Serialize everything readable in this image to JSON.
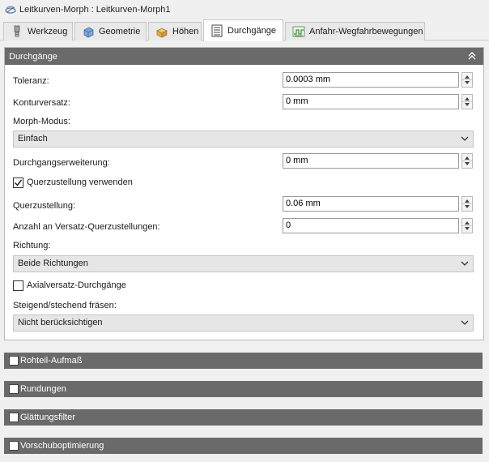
{
  "window": {
    "title": "Leitkurven-Morph : Leitkurven-Morph1"
  },
  "tabs": [
    {
      "label": "Werkzeug"
    },
    {
      "label": "Geometrie"
    },
    {
      "label": "Höhen"
    },
    {
      "label": "Durchgänge"
    },
    {
      "label": "Anfahr-Wegfahrbewegungen"
    }
  ],
  "active_tab": "Durchgänge",
  "panel": {
    "title": "Durchgänge",
    "toleranz": {
      "label": "Toleranz:",
      "value": "0.0003 mm"
    },
    "konturversatz": {
      "label": "Konturversatz:",
      "value": "0 mm"
    },
    "morph_modus": {
      "label": "Morph-Modus:",
      "value": "Einfach"
    },
    "durchgangserweiterung": {
      "label": "Durchgangserweiterung:",
      "value": "0 mm"
    },
    "querzustellung_verwenden": {
      "label": "Querzustellung verwenden",
      "checked": true
    },
    "querzustellung": {
      "label": "Querzustellung:",
      "value": "0.06 mm"
    },
    "anzahl_versatz": {
      "label": "Anzahl an Versatz-Querzustellungen:",
      "value": "0"
    },
    "richtung": {
      "label": "Richtung:",
      "value": "Beide Richtungen"
    },
    "axialversatz": {
      "label": "Axialversatz-Durchgänge",
      "checked": false
    },
    "steigend": {
      "label": "Steigend/stechend fräsen:",
      "value": "Nicht berücksichtigen"
    }
  },
  "sections": [
    {
      "label": "Rohteil-Aufmaß"
    },
    {
      "label": "Rundungen"
    },
    {
      "label": "Glättungsfilter"
    },
    {
      "label": "Vorschuboptimierung"
    }
  ],
  "colors": {
    "header_bg": "#6a6a6a",
    "dropdown_bg": "#e6e6e6",
    "accent": "#3a7bd5"
  }
}
